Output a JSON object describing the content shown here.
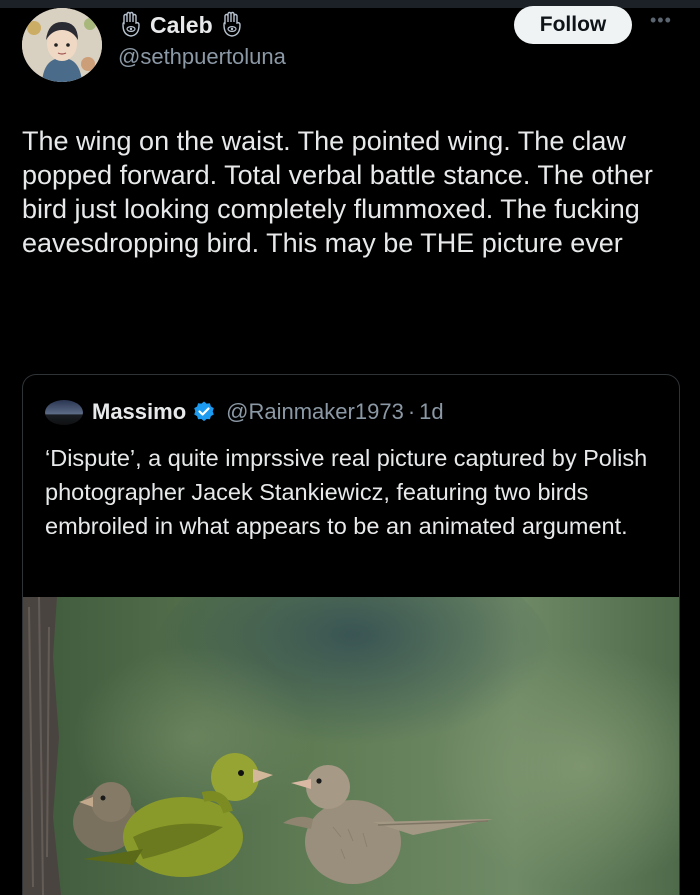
{
  "author": {
    "name": "Caleb",
    "handle": "@sethpuertoluna",
    "badge_icon": "hamsa-icon"
  },
  "follow_label": "Follow",
  "more_icon": "ellipsis-icon",
  "tweet": {
    "text": "The wing on the waist. The pointed wing. The claw popped forward. Total verbal battle stance. The other bird just looking completely flummoxed. The fucking eavesdropping bird. This may be THE picture ever"
  },
  "quote": {
    "name": "Massimo",
    "verified_icon": "verified-badge-icon",
    "handle": "@Rainmaker1973",
    "separator": "·",
    "time": "1d",
    "text": "‘Dispute’, a quite imprssive real picture captured by Polish photographer Jacek Stankiewicz, featuring two birds embroiled in what appears to be an animated argument."
  },
  "colors": {
    "background": "#000000",
    "text": "#e7e9ea",
    "secondary": "#8b98a5",
    "verified": "#1d9bf0",
    "follow_bg": "#eff3f4"
  }
}
